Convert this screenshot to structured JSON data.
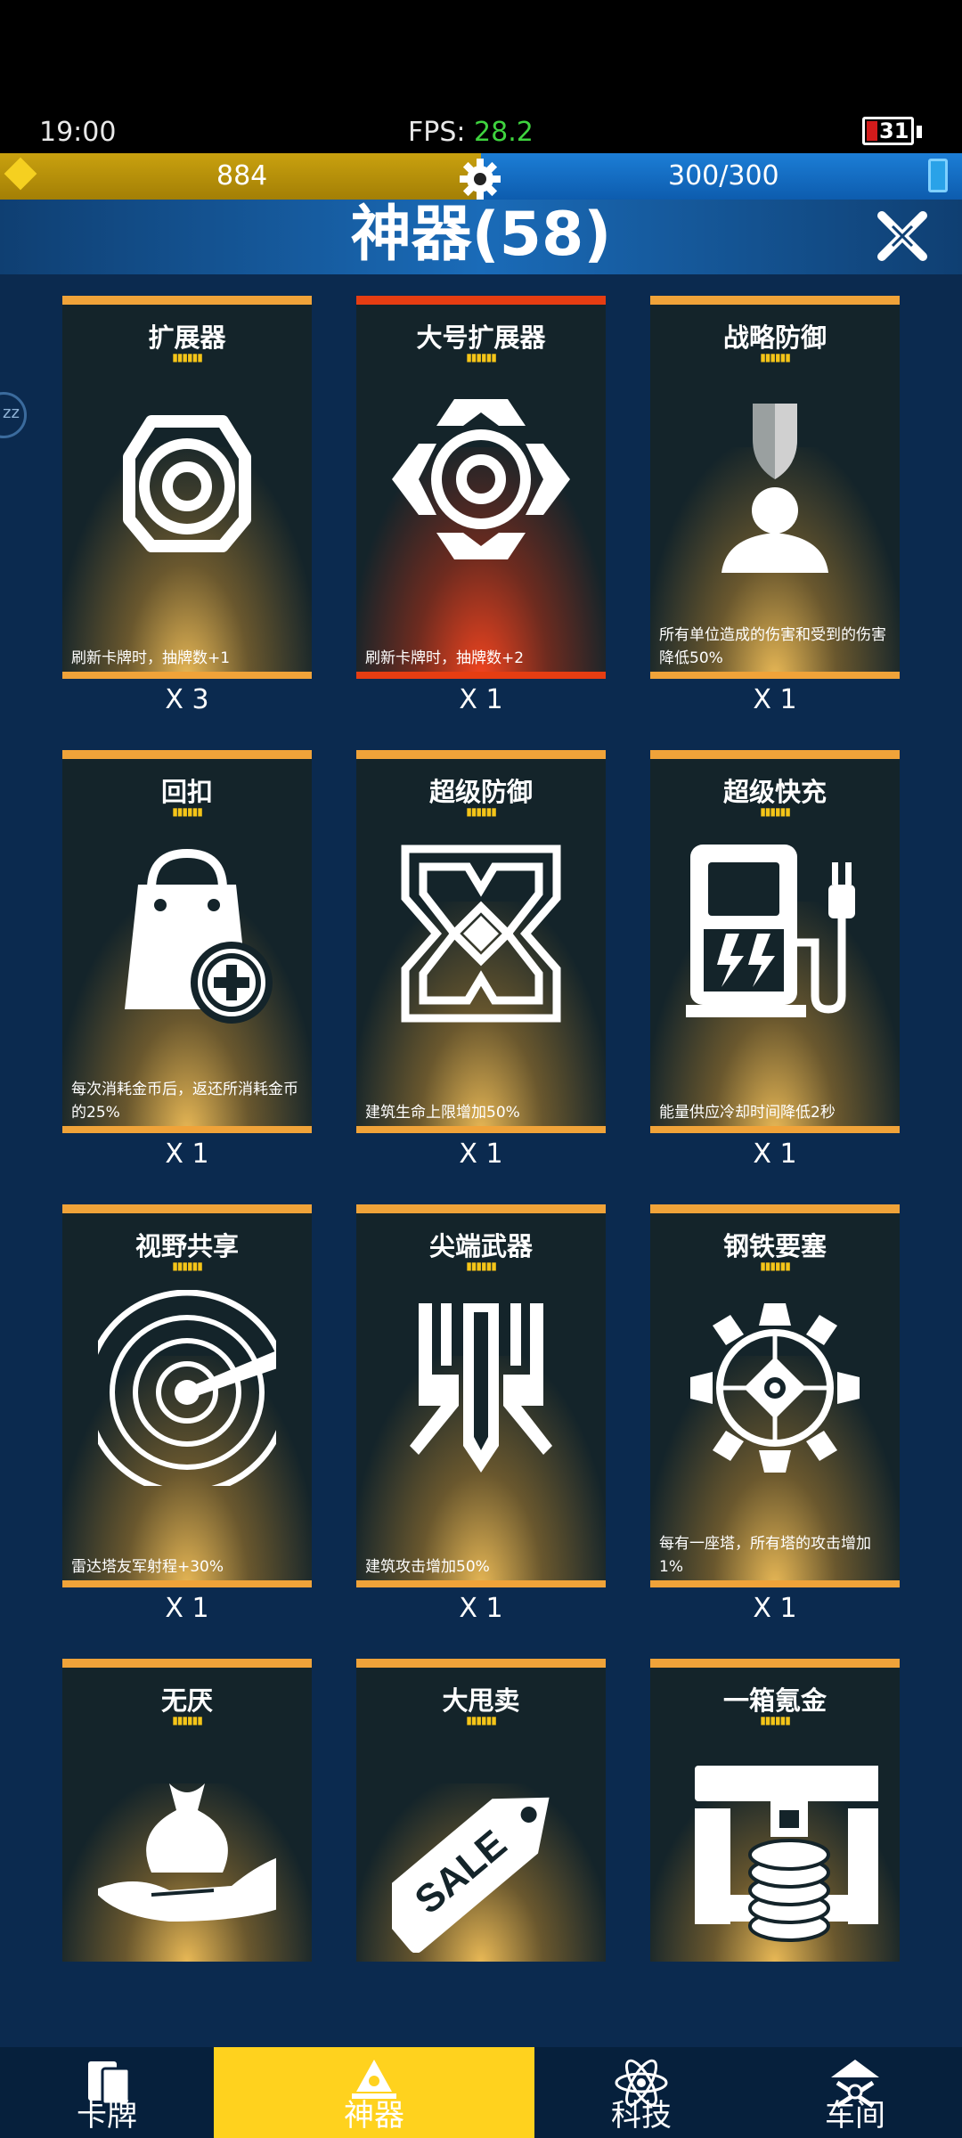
{
  "status": {
    "time": "19:00",
    "fps_label": "FPS:",
    "fps_value": "28.2",
    "battery": "31"
  },
  "resources": {
    "gold": "884",
    "energy": "300/300"
  },
  "header": {
    "title": "神器(58)"
  },
  "side_indicator": "zz",
  "cards": [
    {
      "name": "扩展器",
      "desc": "刷新卡牌时，抽牌数+1",
      "qty": "X 3",
      "rarity": "orange",
      "icon": "octagon-target-icon"
    },
    {
      "name": "大号扩展器",
      "desc": "刷新卡牌时，抽牌数+2",
      "qty": "X 1",
      "rarity": "red",
      "icon": "cross-target-icon"
    },
    {
      "name": "战略防御",
      "desc": "所有单位造成的伤害和受到的伤害降低50%",
      "qty": "X 1",
      "rarity": "orange",
      "icon": "shield-person-icon"
    },
    {
      "name": "回扣",
      "desc": "每次消耗金币后，返还所消耗金币的25%",
      "qty": "X 1",
      "rarity": "orange",
      "icon": "shopping-bag-plus-icon"
    },
    {
      "name": "超级防御",
      "desc": "建筑生命上限增加50%",
      "qty": "X 1",
      "rarity": "orange",
      "icon": "armor-pattern-icon"
    },
    {
      "name": "超级快充",
      "desc": "能量供应冷却时间降低2秒",
      "qty": "X 1",
      "rarity": "orange",
      "icon": "charging-station-icon"
    },
    {
      "name": "视野共享",
      "desc": "雷达塔友军射程+30%",
      "qty": "X 1",
      "rarity": "orange",
      "icon": "radar-icon"
    },
    {
      "name": "尖端武器",
      "desc": "建筑攻击增加50%",
      "qty": "X 1",
      "rarity": "orange",
      "icon": "blade-emblem-icon"
    },
    {
      "name": "钢铁要塞",
      "desc": "每有一座塔，所有塔的攻击增加1%",
      "qty": "X 1",
      "rarity": "orange",
      "icon": "fortress-wheel-icon"
    },
    {
      "name": "无厌",
      "desc": "",
      "qty": "",
      "rarity": "orange",
      "icon": "money-bag-hand-icon"
    },
    {
      "name": "大甩卖",
      "desc": "",
      "qty": "",
      "rarity": "orange",
      "icon": "sale-tag-icon",
      "tag_text": "SALE"
    },
    {
      "name": "一箱氪金",
      "desc": "",
      "qty": "",
      "rarity": "orange",
      "icon": "treasure-chest-coins-icon"
    }
  ],
  "tabs": [
    {
      "label": "卡牌",
      "icon": "cards-icon",
      "active": false
    },
    {
      "label": "神器",
      "icon": "artifact-icon",
      "active": true
    },
    {
      "label": "科技",
      "icon": "atom-icon",
      "active": false
    },
    {
      "label": "车间",
      "icon": "workshop-icon",
      "active": false
    }
  ],
  "colors": {
    "accent_orange": "#f0a339",
    "accent_red": "#e63d12",
    "tab_active": "#ffd21e",
    "fps_green": "#3fd43f"
  }
}
